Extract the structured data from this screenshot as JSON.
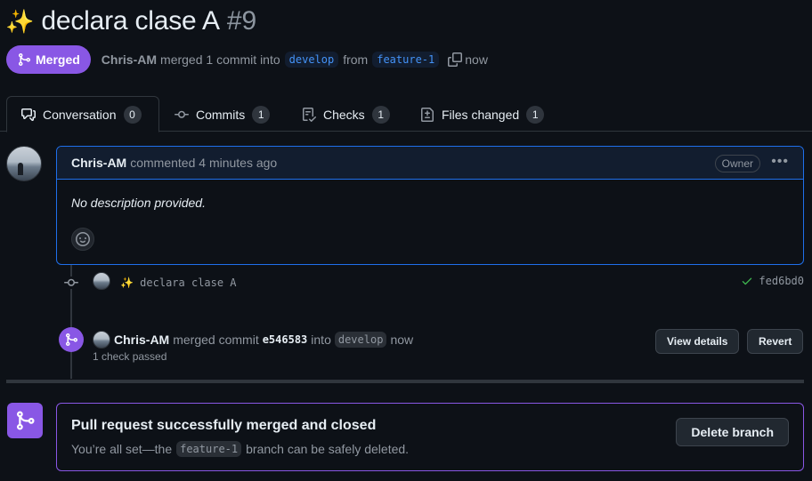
{
  "header": {
    "sparkle": "✨",
    "title": "declara clase A",
    "number": "#9"
  },
  "status": {
    "state_label": "Merged",
    "author": "Chris-AM",
    "text_merged": "merged 1 commit into",
    "base_branch": "develop",
    "text_from": "from",
    "head_branch": "feature-1",
    "time": "now",
    "accent_color": "#8957e5"
  },
  "tabs": [
    {
      "label": "Conversation",
      "count": "0",
      "icon": "comment-discussion-icon"
    },
    {
      "label": "Commits",
      "count": "1",
      "icon": "git-commit-icon"
    },
    {
      "label": "Checks",
      "count": "1",
      "icon": "checklist-icon"
    },
    {
      "label": "Files changed",
      "count": "1",
      "icon": "file-diff-icon"
    }
  ],
  "comment": {
    "author": "Chris-AM",
    "action": "commented 4 minutes ago",
    "role_badge": "Owner",
    "body": "No description provided."
  },
  "timeline": {
    "commit": {
      "message": "✨ declara clase A",
      "sha": "fed6bd0"
    },
    "merge_event": {
      "author": "Chris-AM",
      "text_merged": "merged commit",
      "sha": "e546583",
      "text_into": "into",
      "branch": "develop",
      "time": "now",
      "checks": "1 check passed",
      "view_details_label": "View details",
      "revert_label": "Revert"
    }
  },
  "merged_box": {
    "title": "Pull request successfully merged and closed",
    "sub_prefix": "You’re all set—the",
    "branch": "feature-1",
    "sub_suffix": "branch can be safely deleted.",
    "delete_label": "Delete branch"
  }
}
